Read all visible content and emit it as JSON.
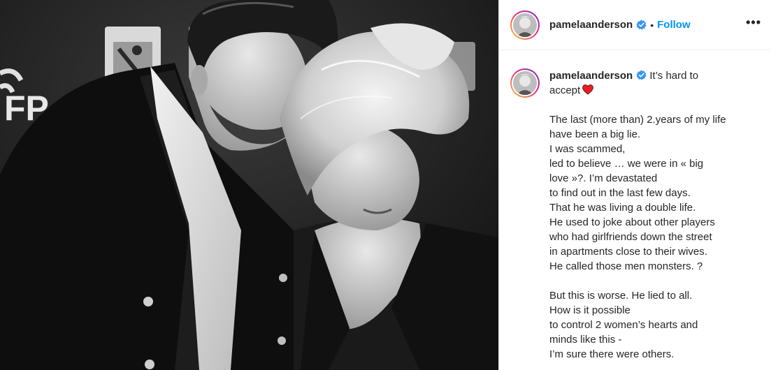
{
  "post": {
    "username": "pamelaanderson",
    "verified": true,
    "separator": "•",
    "follow_label": "Follow",
    "more_label": "•••"
  },
  "caption": {
    "username": "pamelaanderson",
    "first_line": "It’s hard to",
    "second_line": "accept",
    "emoji": "heart",
    "paragraph1": [
      "The last (more than) 2.years of my life",
      "have been a big lie.",
      "I was scammed,",
      "led to believe … we were in « big",
      "love »?. I’m devastated",
      "to find out in the last few days.",
      "That he was living a double life.",
      "He used to joke about other players",
      "who had girlfriends down the street",
      "in apartments close to their wives.",
      "He called those men monsters. ?"
    ],
    "paragraph2": [
      "But this is worse. He lied to all.",
      "How is it possible",
      "to control 2 women’s hearts and",
      "minds like this -",
      "I’m sure there were others."
    ]
  },
  "photo": {
    "backdrop_text": "FP"
  },
  "colors": {
    "follow": "#0095f6",
    "verified": "#3897f0",
    "heart": "#ed1c24",
    "text": "#262626"
  }
}
